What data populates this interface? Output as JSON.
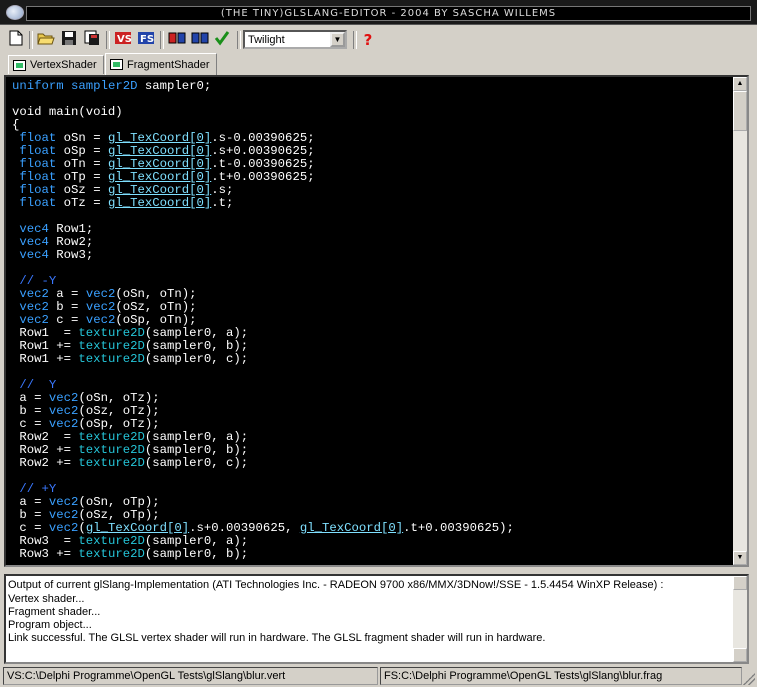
{
  "window": {
    "title": "(THE TINY)GLSLANG-EDITOR  - 2004 BY SASCHA WILLEMS"
  },
  "toolbar": {
    "icons": [
      "new-file-icon",
      "open-folder-icon",
      "save-icon",
      "save-all-icon",
      "vertex-icon",
      "fragment-icon",
      "compile-icon",
      "link-icon",
      "check-icon",
      "help-icon"
    ],
    "theme_value": "Twilight"
  },
  "tabs": [
    {
      "label": "VertexShader"
    },
    {
      "label": "FragmentShader"
    }
  ],
  "editor": {
    "lines": [
      "uniform sampler2D sampler0;",
      "",
      "void main(void)",
      "{",
      " float oSn = gl_TexCoord[0].s-0.00390625;",
      " float oSp = gl_TexCoord[0].s+0.00390625;",
      " float oTn = gl_TexCoord[0].t-0.00390625;",
      " float oTp = gl_TexCoord[0].t+0.00390625;",
      " float oSz = gl_TexCoord[0].s;",
      " float oTz = gl_TexCoord[0].t;",
      "",
      " vec4 Row1;",
      " vec4 Row2;",
      " vec4 Row3;",
      "",
      " // -Y",
      " vec2 a = vec2(oSn, oTn);",
      " vec2 b = vec2(oSz, oTn);",
      " vec2 c = vec2(oSp, oTn);",
      " Row1  = texture2D(sampler0, a);",
      " Row1 += texture2D(sampler0, b);",
      " Row1 += texture2D(sampler0, c);",
      "",
      " //  Y",
      " a = vec2(oSn, oTz);",
      " b = vec2(oSz, oTz);",
      " c = vec2(oSp, oTz);",
      " Row2  = texture2D(sampler0, a);",
      " Row2 += texture2D(sampler0, b);",
      " Row2 += texture2D(sampler0, c);",
      "",
      " // +Y",
      " a = vec2(oSn, oTp);",
      " b = vec2(oSz, oTp);",
      " c = vec2(gl_TexCoord[0].s+0.00390625, gl_TexCoord[0].t+0.00390625);",
      " Row3  = texture2D(sampler0, a);",
      " Row3 += texture2D(sampler0, b);"
    ]
  },
  "output": {
    "lines": [
      "Output of current glSlang-Implementation (ATI Technologies Inc. - RADEON 9700 x86/MMX/3DNow!/SSE - 1.5.4454 WinXP Release) :",
      "Vertex shader...",
      "Fragment shader...",
      "Program object...",
      " Link successful. The GLSL vertex shader will run in hardware. The GLSL fragment shader will run in hardware."
    ]
  },
  "status": {
    "vertex_path": "VS:C:\\Delphi Programme\\OpenGL Tests\\glSlang\\blur.vert",
    "fragment_path": "FS:C:\\Delphi Programme\\OpenGL Tests\\glSlang\\blur.frag"
  }
}
